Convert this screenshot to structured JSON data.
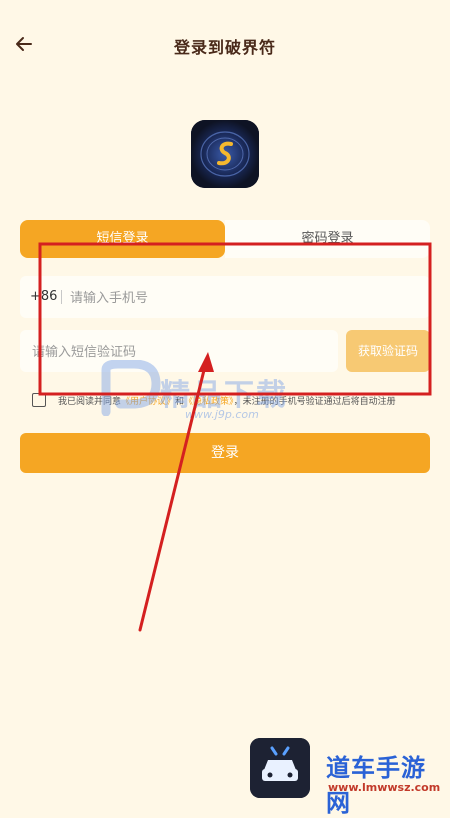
{
  "header": {
    "title": "登录到破界符",
    "back_icon": "arrow-left-icon"
  },
  "login": {
    "tabs": [
      {
        "label": "短信登录",
        "active": true
      },
      {
        "label": "密码登录",
        "active": false
      }
    ],
    "phone": {
      "prefix": "+86",
      "placeholder": "请输入手机号"
    },
    "code": {
      "placeholder": "请输入短信验证码",
      "get_code_label": "获取验证码"
    },
    "agreement": {
      "prefix": "我已阅读并同意",
      "user_agreement": "《用户协议》",
      "and": "和",
      "privacy_policy": "《隐私政策》",
      "suffix": "，未注册的手机号验证通过后将自动注册"
    },
    "submit_label": "登录"
  },
  "watermark": {
    "text": "精品下载",
    "url": "www.j9p.com"
  },
  "footer": {
    "brand": "道车手游网",
    "url": "www.lmwwsz.com"
  },
  "colors": {
    "background": "#fff8e7",
    "accent": "#f5a623",
    "annotation": "#d42020"
  }
}
